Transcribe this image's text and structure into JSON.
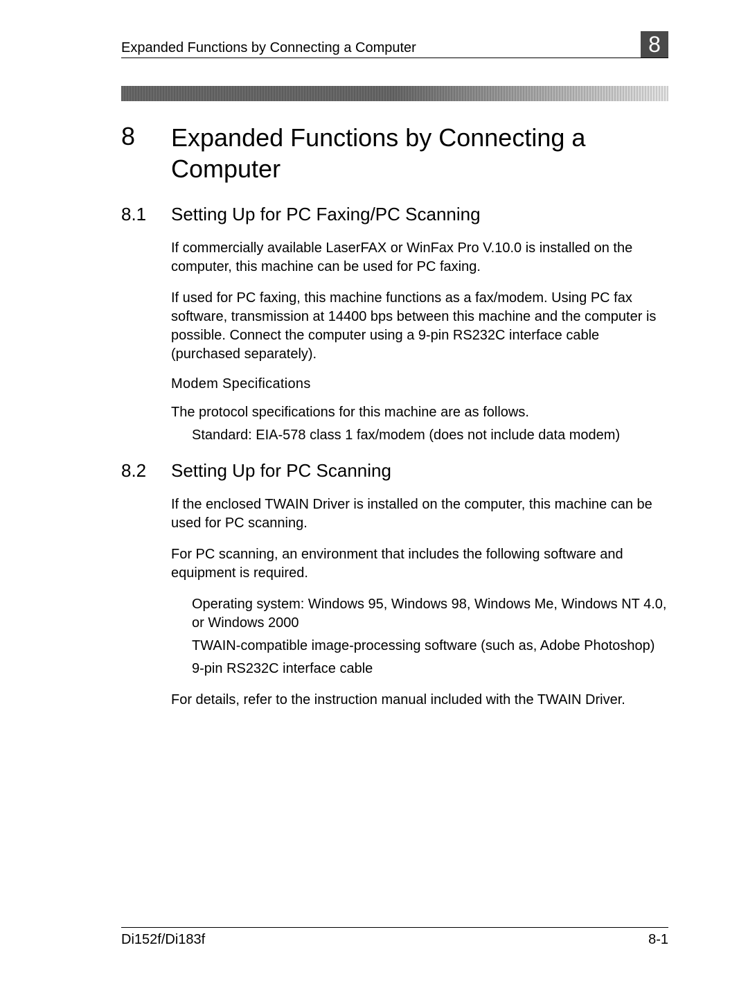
{
  "header": {
    "title": "Expanded Functions by Connecting a Computer",
    "badge": "8"
  },
  "chapter": {
    "num": "8",
    "title": "Expanded Functions by Connecting a Computer"
  },
  "section1": {
    "num": "8.1",
    "title": "Setting Up for PC Faxing/PC Scanning",
    "para1": "If commercially available LaserFAX or WinFax Pro V.10.0 is installed on the computer, this machine can be used for PC faxing.",
    "para2": "If used for PC faxing, this machine functions as a fax/modem. Using PC fax software, transmission at 14400 bps between this machine and the computer is possible. Connect the computer using a 9-pin RS232C interface cable (purchased separately).",
    "subheading": "Modem Specifications",
    "para3": "The protocol specifications for this machine are as follows.",
    "bullet1": "Standard: EIA-578 class 1 fax/modem (does not include data modem)"
  },
  "section2": {
    "num": "8.2",
    "title": "Setting Up for PC Scanning",
    "para1": "If the enclosed TWAIN Driver is installed on the computer, this machine can be used for PC scanning.",
    "para2": "For PC scanning, an environment that includes the following software and equipment is required.",
    "bullet1": "Operating system: Windows 95, Windows 98, Windows Me, Windows NT 4.0, or Windows 2000",
    "bullet2": "TWAIN-compatible image-processing software (such as, Adobe Photoshop)",
    "bullet3": "9-pin RS232C interface cable",
    "para3": "For details, refer to the instruction manual included with the TWAIN Driver."
  },
  "footer": {
    "left": "Di152f/Di183f",
    "right": "8-1"
  }
}
